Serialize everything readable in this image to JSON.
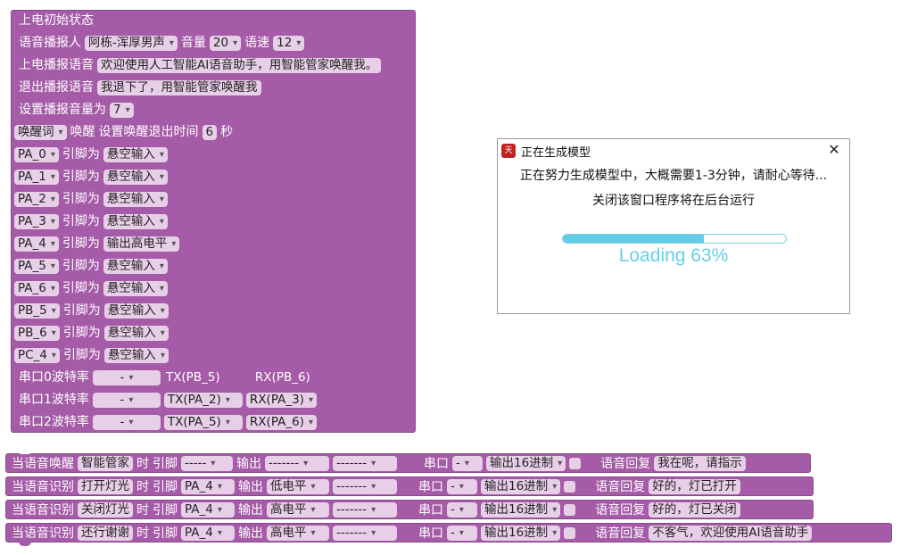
{
  "main": {
    "title": "上电初始状态",
    "voice": {
      "label": "语音播报人",
      "speaker": "阿栋-浑厚男声",
      "volume_label": "音量",
      "volume": "20",
      "speed_label": "语速",
      "speed": "12"
    },
    "power_on": {
      "label": "上电播报语音",
      "text": "欢迎使用人工智能AI语音助手，用智能管家唤醒我。"
    },
    "exit": {
      "label": "退出播报语音",
      "text": "我退下了，用智能管家唤醒我"
    },
    "set_volume": {
      "label": "设置播报音量为",
      "value": "7"
    },
    "wake": {
      "mode": "唤醒词",
      "label": "唤醒",
      "timeout_label": "设置唤醒退出时间",
      "timeout": "6",
      "unit": "秒"
    },
    "pin_label": "引脚为",
    "pins": [
      {
        "name": "PA_0",
        "mode": "悬空输入"
      },
      {
        "name": "PA_1",
        "mode": "悬空输入"
      },
      {
        "name": "PA_2",
        "mode": "悬空输入"
      },
      {
        "name": "PA_3",
        "mode": "悬空输入"
      },
      {
        "name": "PA_4",
        "mode": "输出高电平"
      },
      {
        "name": "PA_5",
        "mode": "悬空输入"
      },
      {
        "name": "PA_6",
        "mode": "悬空输入"
      },
      {
        "name": "PB_5",
        "mode": "悬空输入"
      },
      {
        "name": "PB_6",
        "mode": "悬空输入"
      },
      {
        "name": "PC_4",
        "mode": "悬空输入"
      }
    ],
    "serials": [
      {
        "label": "串口0波特率",
        "baud": "-",
        "tx": "TX(PB_5)",
        "rx": "RX(PB_6)"
      },
      {
        "label": "串口1波特率",
        "baud": "-",
        "tx": "TX(PA_2)",
        "rx": "RX(PA_3)"
      },
      {
        "label": "串口2波特率",
        "baud": "-",
        "tx": "TX(PA_5)",
        "rx": "RX(PA_6)"
      }
    ]
  },
  "labels": {
    "when": "时",
    "pin": "引脚",
    "output": "输出",
    "serial": "串口",
    "reply": "语音回复"
  },
  "rules": [
    {
      "trigger": "当语音唤醒",
      "keyword": "智能管家",
      "pin": "-----",
      "output": "-------",
      "output2": "-------",
      "serial": "-",
      "format": "输出16进制",
      "reply": "我在呢，请指示"
    },
    {
      "trigger": "当语音识别",
      "keyword": "打开灯光",
      "pin": "PA_4",
      "output": "低电平",
      "output2": "-------",
      "serial": "-",
      "format": "输出16进制",
      "reply": "好的，灯已打开"
    },
    {
      "trigger": "当语音识别",
      "keyword": "关闭灯光",
      "pin": "PA_4",
      "output": "高电平",
      "output2": "-------",
      "serial": "-",
      "format": "输出16进制",
      "reply": "好的，灯已关闭"
    },
    {
      "trigger": "当语音识别",
      "keyword": "还行谢谢",
      "pin": "PA_4",
      "output": "高电平",
      "output2": "-------",
      "serial": "-",
      "format": "输出16进制",
      "reply": "不客气，欢迎使用AI语音助手"
    }
  ],
  "dialog": {
    "title": "正在生成模型",
    "icon_text": "天问",
    "close": "✕",
    "message": "正在努力生成模型中，大概需要1-3分钟，请耐心等待...",
    "hint": "关闭该窗口程序将在后台运行",
    "progress": 63,
    "loading_text": "Loading 63%"
  },
  "colors": {
    "block": "#a55ba7",
    "field": "#e7cfe7",
    "progress": "#62cde5"
  }
}
